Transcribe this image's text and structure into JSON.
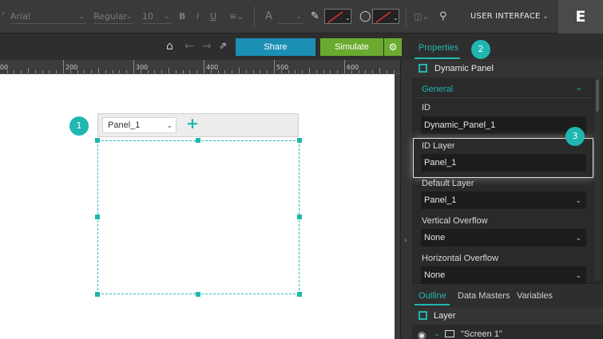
{
  "toolbar": {
    "font_family": "Arial",
    "font_style": "Regular",
    "font_size": "10",
    "bold": "B",
    "italic": "I",
    "underline": "U",
    "text_size_glyph": "A",
    "interface_menu": "USER INTERFACE",
    "user_initial": "E"
  },
  "actions": {
    "share_label": "Share",
    "simulate_label": "Simulate"
  },
  "ruler": {
    "labels": [
      "00",
      "200",
      "300",
      "400",
      "500",
      "600"
    ]
  },
  "canvas": {
    "panel_select": "Panel_1"
  },
  "steps": [
    "1",
    "2",
    "3"
  ],
  "properties": {
    "tab_label": "Properties",
    "component_title": "Dynamic Panel",
    "section_label": "General",
    "fields": [
      {
        "label": "ID",
        "value": "Dynamic_Panel_1"
      },
      {
        "label": "ID Layer",
        "value": "Panel_1"
      },
      {
        "label": "Default Layer",
        "value": "Panel_1"
      },
      {
        "label": "Vertical Overflow",
        "value": "None"
      },
      {
        "label": "Horizontal Overflow",
        "value": "None"
      }
    ]
  },
  "outline": {
    "tabs": [
      "Outline",
      "Data Masters",
      "Variables"
    ],
    "layer_title": "Layer",
    "screen_label": "\"Screen 1\""
  },
  "colors": {
    "accent": "#1fb7b0",
    "share": "#1c8fb5",
    "simulate": "#6aab2f"
  }
}
